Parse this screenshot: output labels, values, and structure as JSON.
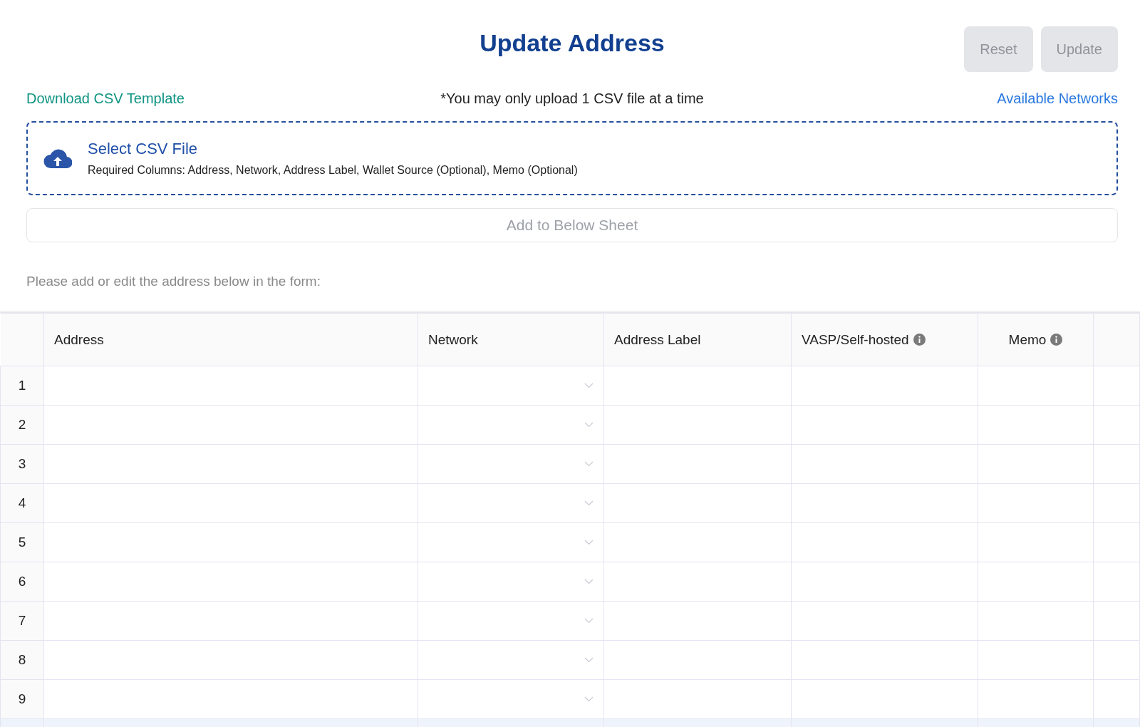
{
  "title": "Update Address",
  "buttons": [
    {
      "label": "Reset",
      "disabled": true
    },
    {
      "label": "Update",
      "disabled": true
    }
  ],
  "download_link": "Download CSV Template",
  "upload_note": "*You may only upload 1 CSV file at a time",
  "networks_link": "Available Networks",
  "dropzone": {
    "title": "Select CSV File",
    "hint": "Required Columns: Address, Network, Address Label, Wallet Source (Optional), Memo (Optional)"
  },
  "add_button": {
    "label": "Add to Below Sheet",
    "disabled": true
  },
  "form_hint": "Please add or edit the address below in the form:",
  "table": {
    "columns": [
      {
        "label": "Address",
        "info": false,
        "kind": "text"
      },
      {
        "label": "Network",
        "info": false,
        "kind": "select"
      },
      {
        "label": "Address Label",
        "info": false,
        "kind": "text"
      },
      {
        "label": "VASP/Self-hosted",
        "info": true,
        "kind": "text"
      },
      {
        "label": "Memo",
        "info": true,
        "kind": "text"
      }
    ],
    "rows": [
      {
        "number": "1"
      },
      {
        "number": "2"
      },
      {
        "number": "3"
      },
      {
        "number": "4"
      },
      {
        "number": "5"
      },
      {
        "number": "6"
      },
      {
        "number": "7"
      },
      {
        "number": "8"
      },
      {
        "number": "9"
      }
    ]
  }
}
